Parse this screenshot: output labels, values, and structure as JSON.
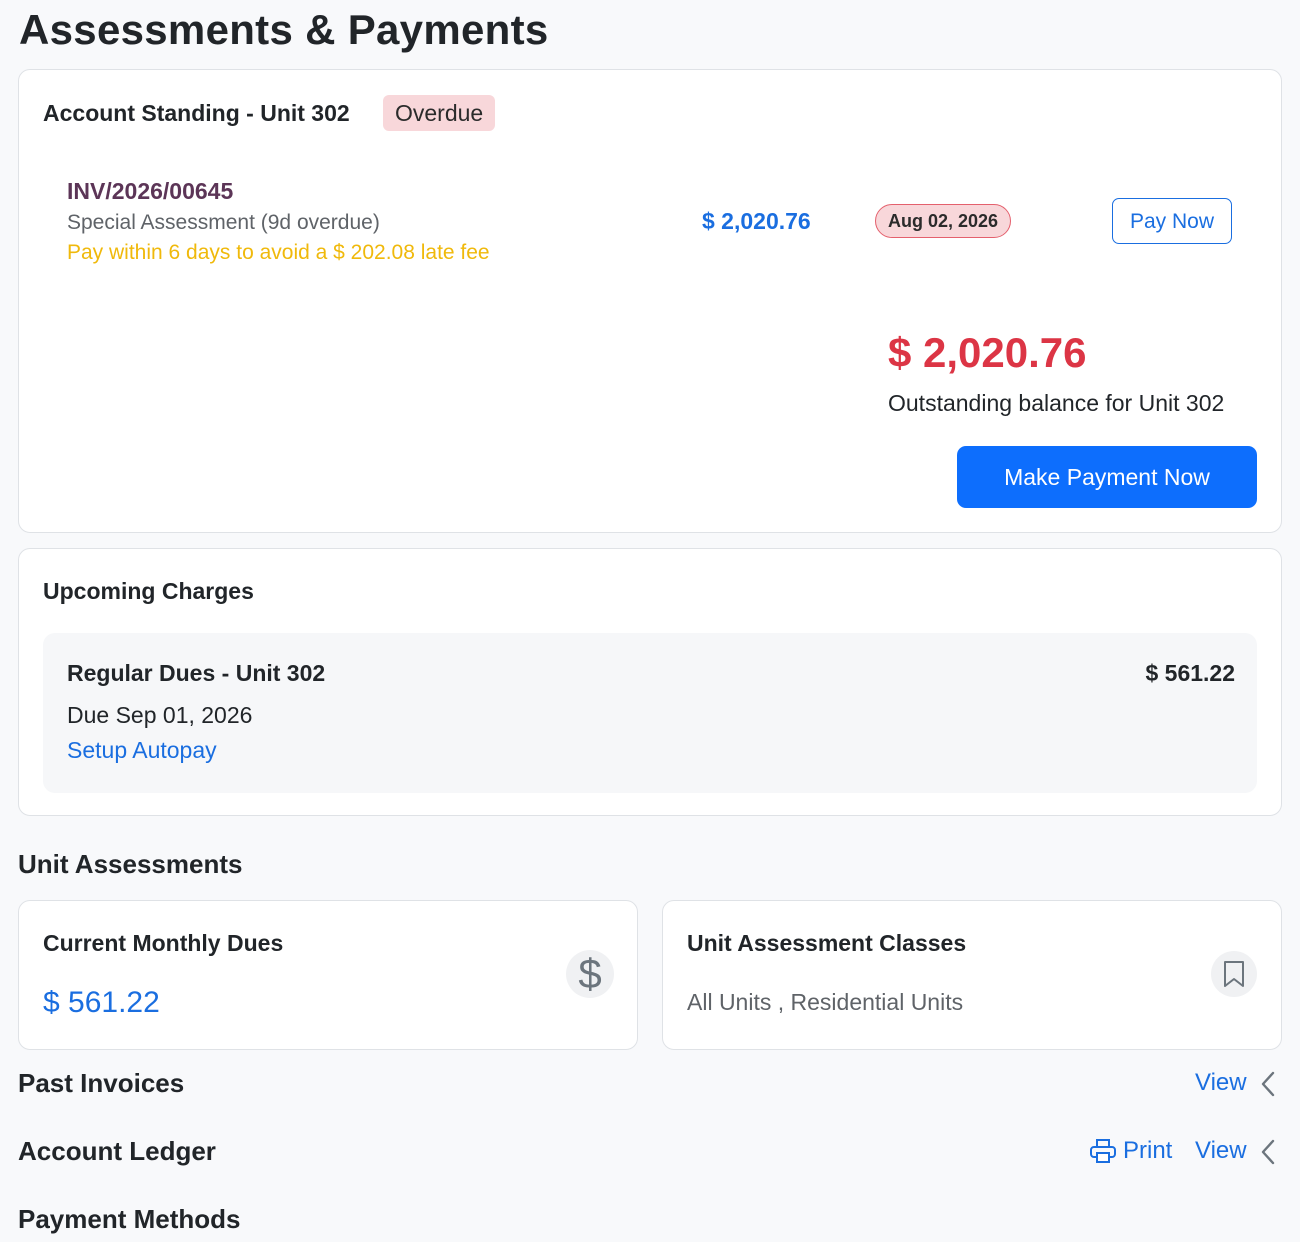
{
  "page": {
    "title": "Assessments & Payments"
  },
  "account_standing": {
    "title": "Account Standing - Unit 302",
    "status_badge": "Overdue",
    "invoice": {
      "number": "INV/2026/00645",
      "type": "Special Assessment (9d overdue)",
      "warning": "Pay within 6 days to avoid a $ 202.08 late fee",
      "amount": "$ 2,020.76",
      "due_date": "Aug 02, 2026",
      "pay_label": "Pay Now"
    },
    "outstanding_amount": "$ 2,020.76",
    "outstanding_label": "Outstanding balance for Unit 302",
    "make_payment_label": "Make Payment Now"
  },
  "upcoming_charges": {
    "title": "Upcoming Charges",
    "items": [
      {
        "title": "Regular Dues - Unit 302",
        "amount": "$ 561.22",
        "due": "Due Sep 01, 2026",
        "autopay_label": "Setup Autopay"
      }
    ]
  },
  "unit_assessments": {
    "heading": "Unit Assessments",
    "monthly_dues": {
      "title": "Current Monthly Dues",
      "amount": "$ 561.22",
      "icon": "dollar-icon"
    },
    "classes": {
      "title": "Unit Assessment Classes",
      "value": "All Units , Residential Units",
      "icon": "bookmark-icon"
    }
  },
  "sections": {
    "past_invoices": {
      "title": "Past Invoices",
      "view_label": "View",
      "icon": "chevron-left-icon"
    },
    "account_ledger": {
      "title": "Account Ledger",
      "print_label": "Print",
      "view_label": "View",
      "print_icon": "printer-icon",
      "icon": "chevron-left-icon"
    },
    "payment_methods": {
      "title": "Payment Methods"
    }
  },
  "colors": {
    "accent": "#0d6efd",
    "link": "#1a6ee0",
    "danger": "#dc3545",
    "warning": "#f0b90b",
    "invoice_number": "#5c3557",
    "badge_bg": "#f8d7da"
  }
}
